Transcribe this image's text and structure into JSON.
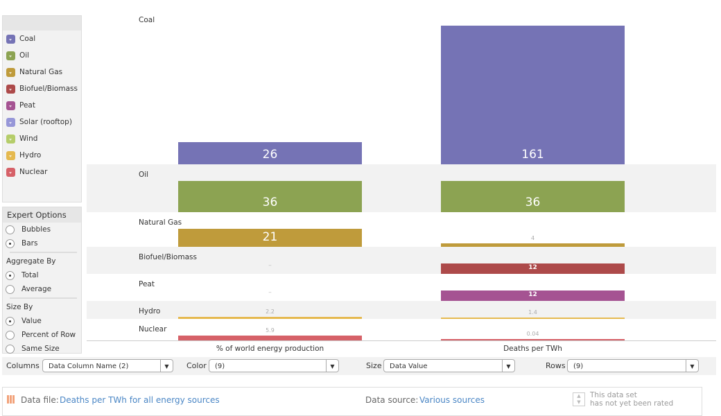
{
  "legend": {
    "items": [
      {
        "label": "Coal",
        "color": "#7573b5"
      },
      {
        "label": "Oil",
        "color": "#8ca352"
      },
      {
        "label": "Natural Gas",
        "color": "#bf9b3b"
      },
      {
        "label": "Biofuel/Biomass",
        "color": "#ad4a4a"
      },
      {
        "label": "Peat",
        "color": "#a55392"
      },
      {
        "label": "Solar (rooftop)",
        "color": "#9797d8"
      },
      {
        "label": "Wind",
        "color": "#b5cd6a"
      },
      {
        "label": "Hydro",
        "color": "#e5b94f"
      },
      {
        "label": "Nuclear",
        "color": "#d66168"
      }
    ]
  },
  "expert": {
    "title": "Expert Options",
    "bubbles": "Bubbles",
    "bars": "Bars",
    "aggregate_label": "Aggregate By",
    "total": "Total",
    "average": "Average",
    "size_label": "Size By",
    "value": "Value",
    "percent_row": "Percent of Row",
    "same_size": "Same Size",
    "selected": {
      "type": "Bars",
      "aggregate": "Total",
      "size": "Value"
    }
  },
  "chart_data": {
    "type": "bar",
    "columns": [
      "% of world energy production",
      "Deaths per TWh"
    ],
    "rows": [
      {
        "name": "Coal",
        "color": "#7573b5",
        "values": [
          26,
          161
        ]
      },
      {
        "name": "Oil",
        "color": "#8ca352",
        "values": [
          36,
          36
        ]
      },
      {
        "name": "Natural Gas",
        "color": "#bf9b3b",
        "values": [
          21,
          4
        ]
      },
      {
        "name": "Biofuel/Biomass",
        "color": "#ad4a4a",
        "values": [
          null,
          12
        ]
      },
      {
        "name": "Peat",
        "color": "#a55392",
        "values": [
          null,
          12
        ]
      },
      {
        "name": "Hydro",
        "color": "#e5b94f",
        "values": [
          2.2,
          1.4
        ]
      },
      {
        "name": "Nuclear",
        "color": "#d66168",
        "values": [
          5.9,
          0.04
        ]
      }
    ],
    "missing_label": "–",
    "band_colors": [
      "#ffffff",
      "#f2f2f2"
    ]
  },
  "toolbar": {
    "columns_label": "Columns",
    "columns_value": "Data Column Name (2)",
    "color_label": "Color",
    "color_value": "(9)",
    "size_label": "Size",
    "size_value": "Data Value",
    "rows_label": "Rows",
    "rows_value": "(9)"
  },
  "footer": {
    "data_file_label": "Data file:",
    "data_file": "Deaths per TWh for all energy sources",
    "data_source_label": "Data source:",
    "data_source": "Various sources",
    "rating_line1": "This data set",
    "rating_line2": "has not yet been rated"
  }
}
